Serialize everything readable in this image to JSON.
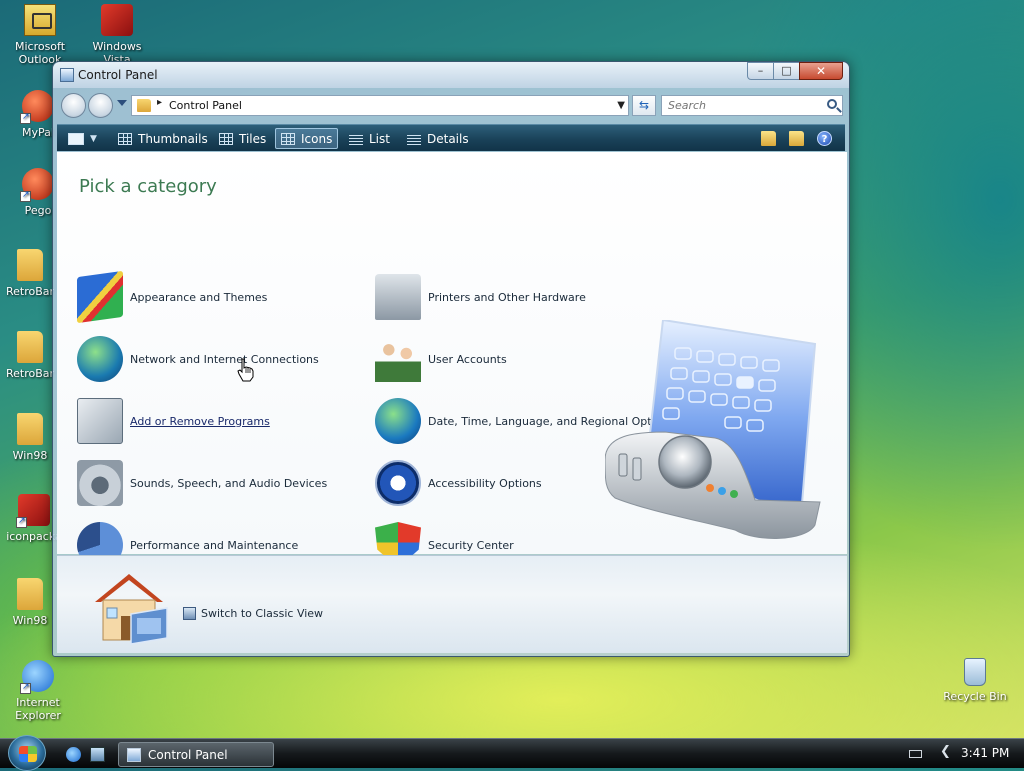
{
  "desktop": {
    "icons": [
      {
        "label": "Microsoft Outlook"
      },
      {
        "label": "Windows Vista"
      },
      {
        "label": "MyPal"
      },
      {
        "label": "Pego"
      },
      {
        "label": "RetroBar"
      },
      {
        "label": "RetroBar"
      },
      {
        "label": "Win98"
      },
      {
        "label": "iconpacka"
      },
      {
        "label": "Win98"
      },
      {
        "label": "Internet Explorer"
      },
      {
        "label": "Recycle Bin"
      }
    ]
  },
  "window": {
    "title": "Control Panel",
    "caption": {
      "minimize": "–",
      "maximize": "□",
      "close": "✕"
    },
    "address": {
      "path": "Control Panel",
      "separator": "▸",
      "dropdown": "▼"
    },
    "refresh_glyph": "⇆",
    "search": {
      "placeholder": "Search"
    },
    "toolbar": {
      "items": [
        {
          "label": "Thumbnails"
        },
        {
          "label": "Tiles"
        },
        {
          "label": "Icons",
          "active": true
        },
        {
          "label": "List"
        },
        {
          "label": "Details"
        }
      ],
      "help_glyph": "?"
    },
    "content": {
      "heading": "Pick a category",
      "categories_left": [
        {
          "label": "Appearance and Themes",
          "icon": "appearance-icon"
        },
        {
          "label": "Network and Internet Connections",
          "icon": "network-icon"
        },
        {
          "label": "Add or Remove Programs",
          "icon": "add-remove-icon",
          "hovered": true
        },
        {
          "label": "Sounds, Speech, and Audio Devices",
          "icon": "sounds-icon"
        },
        {
          "label": "Performance and Maintenance",
          "icon": "performance-icon"
        }
      ],
      "categories_right": [
        {
          "label": "Printers and Other Hardware",
          "icon": "printer-icon"
        },
        {
          "label": "User Accounts",
          "icon": "users-icon"
        },
        {
          "label": "Date, Time, Language, and Regional Options",
          "icon": "globe-clock-icon"
        },
        {
          "label": "Accessibility Options",
          "icon": "accessibility-icon"
        },
        {
          "label": "Security Center",
          "icon": "shield-icon"
        }
      ]
    },
    "bottom": {
      "classic_view_label": "Switch to Classic View"
    }
  },
  "taskbar": {
    "task_label": "Control Panel",
    "tray_chevron": "❮",
    "clock": "3:41 PM"
  }
}
